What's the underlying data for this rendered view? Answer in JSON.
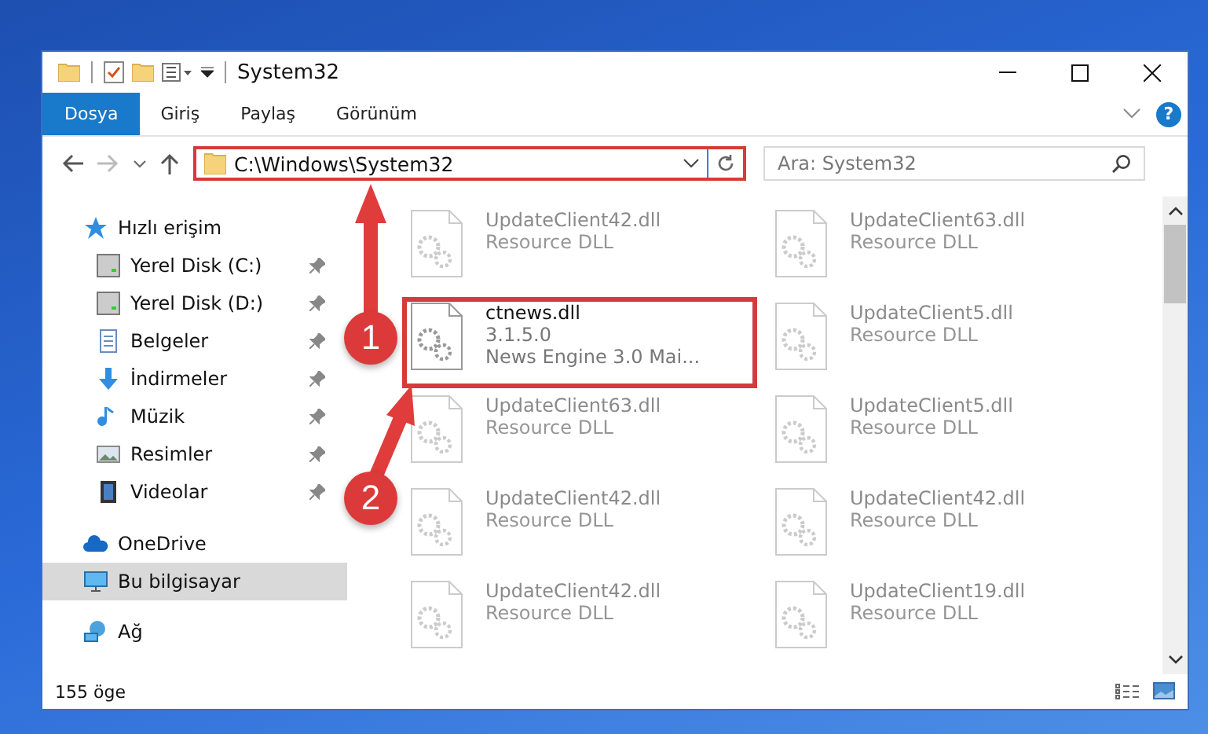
{
  "window": {
    "title": "System32"
  },
  "ribbon": {
    "tabs": [
      {
        "label": "Dosya",
        "selected": true
      },
      {
        "label": "Giriş",
        "selected": false
      },
      {
        "label": "Paylaş",
        "selected": false
      },
      {
        "label": "Görünüm",
        "selected": false
      }
    ],
    "help": "?"
  },
  "address": {
    "path": "C:\\Windows\\System32",
    "highlighted": true
  },
  "search": {
    "placeholder": "Ara: System32"
  },
  "sidebar": {
    "items": [
      {
        "label": "Hızlı erişim",
        "kind": "star",
        "selected": false,
        "children": [
          {
            "label": "Yerel Disk (C:)",
            "kind": "drive",
            "pinned": true,
            "selected": false
          },
          {
            "label": "Yerel Disk (D:)",
            "kind": "drive",
            "pinned": true,
            "selected": false
          },
          {
            "label": "Belgeler",
            "kind": "document",
            "pinned": true,
            "selected": false
          },
          {
            "label": "İndirmeler",
            "kind": "download",
            "pinned": true,
            "selected": false
          },
          {
            "label": "Müzik",
            "kind": "music",
            "pinned": true,
            "selected": false
          },
          {
            "label": "Resimler",
            "kind": "picture",
            "pinned": true,
            "selected": false
          },
          {
            "label": "Videolar",
            "kind": "video",
            "pinned": true,
            "selected": false
          }
        ]
      },
      {
        "label": "OneDrive",
        "kind": "cloud",
        "selected": false
      },
      {
        "label": "Bu bilgisayar",
        "kind": "computer",
        "selected": true
      },
      {
        "label": "Ağ",
        "kind": "network",
        "selected": false
      }
    ]
  },
  "files": [
    {
      "name": "UpdateClient42.dll",
      "lines": [
        "Resource DLL"
      ],
      "faded": true,
      "highlighted": false
    },
    {
      "name": "UpdateClient63.dll",
      "lines": [
        "Resource DLL"
      ],
      "faded": true,
      "highlighted": false
    },
    {
      "name": "ctnews.dll",
      "lines": [
        "3.1.5.0",
        "News Engine 3.0 Mai..."
      ],
      "faded": false,
      "highlighted": true
    },
    {
      "name": "UpdateClient5.dll",
      "lines": [
        "Resource DLL"
      ],
      "faded": true,
      "highlighted": false
    },
    {
      "name": "UpdateClient63.dll",
      "lines": [
        "Resource DLL"
      ],
      "faded": true,
      "highlighted": false
    },
    {
      "name": "UpdateClient5.dll",
      "lines": [
        "Resource DLL"
      ],
      "faded": true,
      "highlighted": false
    },
    {
      "name": "UpdateClient42.dll",
      "lines": [
        "Resource DLL"
      ],
      "faded": true,
      "highlighted": false
    },
    {
      "name": "UpdateClient42.dll",
      "lines": [
        "Resource DLL"
      ],
      "faded": true,
      "highlighted": false
    },
    {
      "name": "UpdateClient42.dll",
      "lines": [
        "Resource DLL"
      ],
      "faded": true,
      "highlighted": false
    },
    {
      "name": "UpdateClient19.dll",
      "lines": [
        "Resource DLL"
      ],
      "faded": true,
      "highlighted": false
    }
  ],
  "status_bar": {
    "count": "155 öge"
  },
  "callouts": [
    {
      "number": "1"
    },
    {
      "number": "2"
    }
  ]
}
